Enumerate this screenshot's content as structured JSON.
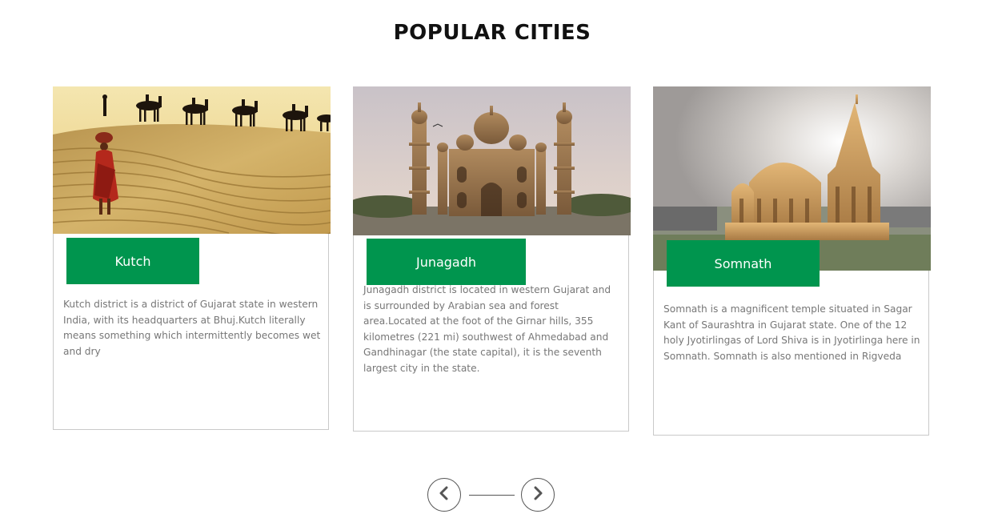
{
  "section": {
    "title": "POPULAR CITIES"
  },
  "cards": [
    {
      "label": "Kutch",
      "image_subject": "desert camel caravan",
      "description": "Kutch district is a district of Gujarat state in western India, with its headquarters at Bhuj.Kutch literally means something which intermittently becomes wet and dry"
    },
    {
      "label": "Junagadh",
      "image_subject": "mahabat maqbara mausoleum",
      "description": "Junagadh district is located in western Gujarat and is surrounded by Arabian sea and forest area.Located at the foot of the Girnar hills, 355 kilometres (221 mi) southwest of Ahmedabad and Gandhinagar (the state capital), it is the seventh largest city in the state."
    },
    {
      "label": "Somnath",
      "image_subject": "somnath temple",
      "description": "Somnath is a magnificent temple situated in Sagar Kant of Saurashtra in Gujarat state. One of the 12 holy Jyotirlingas of Lord Shiva is in Jyotirlinga here in Somnath. Somnath is also mentioned in Rigveda"
    }
  ],
  "navigation": {
    "prev_icon": "chevron-left-icon",
    "next_icon": "chevron-right-icon"
  },
  "colors": {
    "accent": "#00954e",
    "title": "#111111",
    "body_text": "#777777",
    "card_border": "#c9c9c9"
  }
}
